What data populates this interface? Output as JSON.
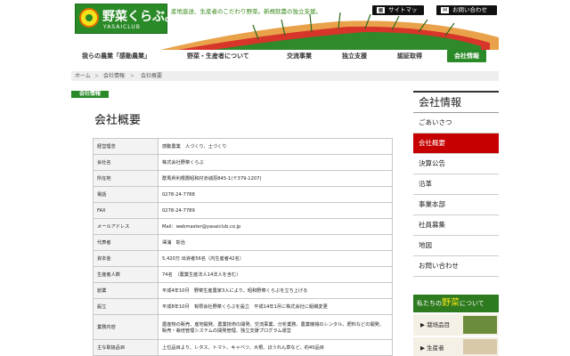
{
  "brand": {
    "name": "野菜くらぶ。",
    "sub": "YASAICLUB"
  },
  "header": {
    "tagline": "産地直送、生産者のこだわり野菜。新規就農の独立支援。",
    "sitemap": "サイトマップ",
    "contact": "お問い合わせ"
  },
  "nav": {
    "items": [
      "我らの農業「感動農業」",
      "野菜・生産者について",
      "交流事業",
      "独立支援",
      "認証取得",
      "会社情報"
    ]
  },
  "breadcrumb": [
    "ホーム",
    "会社情報",
    "会社概要"
  ],
  "section_label": "会社情報",
  "page_title": "会社概要",
  "company": [
    {
      "k": "経営理念",
      "v": "感動農業　人づくり、土づくり"
    },
    {
      "k": "会社名",
      "v": "株式会社野菜くらぶ"
    },
    {
      "k": "所在地",
      "v": "群馬県利根郡昭和村赤城原845-1(〒379-1207)"
    },
    {
      "k": "電話",
      "v": "0278-24-7788"
    },
    {
      "k": "FAX",
      "v": "0278-24-7789"
    },
    {
      "k": "メールアドレス",
      "v": "Mail：webmaster@yasaiclub.co.jp"
    },
    {
      "k": "代表者",
      "v": "澤浦　彰治"
    },
    {
      "k": "資本金",
      "v": "5,420万 出資者56名（内生産者42名）"
    },
    {
      "k": "生産者人数",
      "v": "74名　（農業生産法人14法人を含む）"
    },
    {
      "k": "創業",
      "v": "平成4年10月　野菜生産農家3人により、昭和野菜くらぶを立ち上げる"
    },
    {
      "k": "設立",
      "v": "平成8年10月　有限会社野菜くらぶを設立　平成14年1月に株式会社に組織変更"
    },
    {
      "k": "業務内容",
      "v": "農産物の販売、産地開発、農業技術の開発、交流事業、分析業務、農業機械のレンタル、肥料などの開発、販売・栽培管理システムの開発管理、独立支援プログラム運営"
    },
    {
      "k": "主な取扱品目",
      "v": "上位品目より、レタス、トマト、キャベツ、大根、ほうれん草など、約40品目"
    }
  ],
  "sidebar": {
    "heading": "会社情報",
    "items": [
      "ごあいさつ",
      "会社概要",
      "決算公告",
      "沿革",
      "事業本部",
      "社員募集",
      "地図",
      "お問い合わせ"
    ]
  },
  "promo": {
    "title_a": "私たちの",
    "title_b": "野菜",
    "title_c": "について",
    "row1": "▶ 栽培品目",
    "row2": "▶ 生産者"
  }
}
